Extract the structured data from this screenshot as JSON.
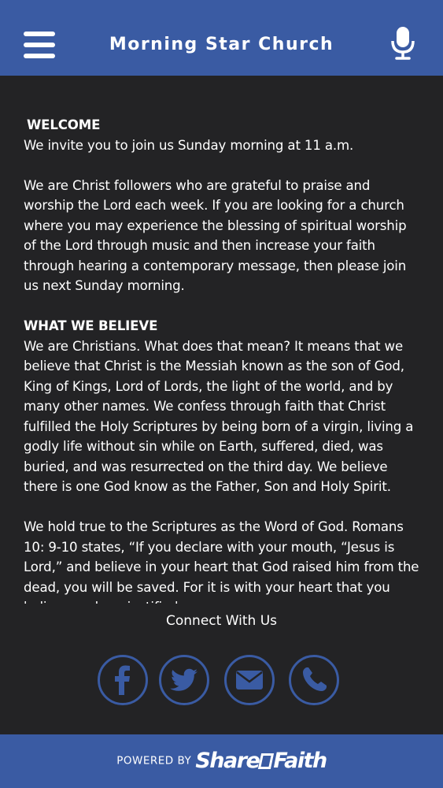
{
  "header": {
    "title": "Morning Star Church",
    "menu_icon": "hamburger-menu-icon",
    "mic_icon": "microphone-icon"
  },
  "content": {
    "welcome_heading": "WELCOME",
    "welcome_text": "We invite you to join us Sunday morning at 11 a.m.",
    "intro_text": "We are Christ followers who are grateful to praise and worship the Lord each week.  If you are looking for a church where you may experience the blessing of spiritual worship of the Lord through music and then increase your faith through hearing a contemporary message, then please join us next Sunday morning.",
    "believe_heading": "WHAT WE BELIEVE",
    "believe_text": "We are Christians. What does that mean? It means that we believe that Christ is the Messiah known as the son of God, King of Kings, Lord of Lords, the light of the world, and by many other names. We confess through faith that Christ fulfilled the Holy Scriptures by being born of a virgin, living a godly life without sin while on Earth, suffered, died, was buried, and was resurrected on the third day.  We believe there is one God know as the Father, Son and Holy Spirit.",
    "scripture_text": "We hold true to the Scriptures as the Word of God. Romans 10: 9-10 states, “If you declare with your mouth, “Jesus is Lord,” and believe in your heart that God raised him from the dead, you will be saved. For it is with your heart that you believe and are justified"
  },
  "connect": {
    "label": "Connect With Us",
    "icons": [
      "facebook-icon",
      "twitter-icon",
      "email-icon",
      "phone-icon"
    ]
  },
  "footer": {
    "powered_by": "POWERED BY",
    "brand_part1": "Share",
    "brand_part2": "Faith"
  },
  "colors": {
    "header_bg": "#3a5ba3",
    "body_bg": "#232325",
    "text": "#ffffff"
  }
}
